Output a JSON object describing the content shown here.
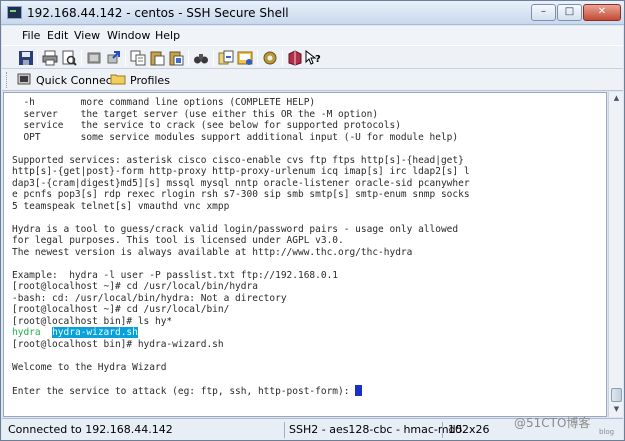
{
  "window": {
    "title": "192.168.44.142 - centos - SSH Secure Shell"
  },
  "window_buttons": {
    "minimize": "–",
    "maximize": "□",
    "close": "✕"
  },
  "menu": {
    "items": [
      "File",
      "Edit",
      "View",
      "Window",
      "Help"
    ]
  },
  "toolbar": {
    "icons": [
      "save-icon",
      "print-icon",
      "print-preview-icon",
      "disconnect-icon",
      "quick-connect-icon",
      "copy-icon",
      "paste-icon",
      "paste-special-icon",
      "find-icon",
      "file-transfer-icon",
      "new-terminal-icon",
      "settings-icon",
      "profiles-book-icon",
      "help-pointer-icon"
    ]
  },
  "profilebar": {
    "quick_connect": "Quick Connect",
    "profiles": "Profiles"
  },
  "terminal": {
    "lines": [
      "  -h        more command line options (COMPLETE HELP)",
      "  server    the target server (use either this OR the -M option)",
      "  service   the service to crack (see below for supported protocols)",
      "  OPT       some service modules support additional input (-U for module help)",
      "",
      "Supported services: asterisk cisco cisco-enable cvs ftp ftps http[s]-{head|get}",
      "http[s]-{get|post}-form http-proxy http-proxy-urlenum icq imap[s] irc ldap2[s] l",
      "dap3[-{cram|digest}md5][s] mssql mysql nntp oracle-listener oracle-sid pcanywher",
      "e pcnfs pop3[s] rdp rexec rlogin rsh s7-300 sip smb smtp[s] smtp-enum snmp socks",
      "5 teamspeak telnet[s] vmauthd vnc xmpp",
      "",
      "Hydra is a tool to guess/crack valid login/password pairs - usage only allowed",
      "for legal purposes. This tool is licensed under AGPL v3.0.",
      "The newest version is always available at http://www.thc.org/thc-hydra",
      "",
      "Example:  hydra -l user -P passlist.txt ftp://192.168.0.1",
      "[root@localhost ~]# cd /usr/local/bin/hydra",
      "-bash: cd: /usr/local/bin/hydra: Not a directory",
      "[root@localhost ~]# cd /usr/local/bin/",
      "[root@localhost bin]# ls hy*"
    ],
    "ls_result_first": "hydra",
    "ls_result_second": "hydra-wizard.sh",
    "after_lines": [
      "[root@localhost bin]# hydra-wizard.sh",
      "",
      "Welcome to the Hydra Wizard",
      ""
    ],
    "prompt_line": "Enter the service to attack (eg: ftp, ssh, http-post-form): "
  },
  "statusbar": {
    "connection": "Connected to 192.168.44.142",
    "cipher": "SSH2 - aes128-cbc - hmac-md5",
    "size": "102x26"
  },
  "watermark": {
    "text": "@51CTO博客",
    "sub": "blog"
  }
}
